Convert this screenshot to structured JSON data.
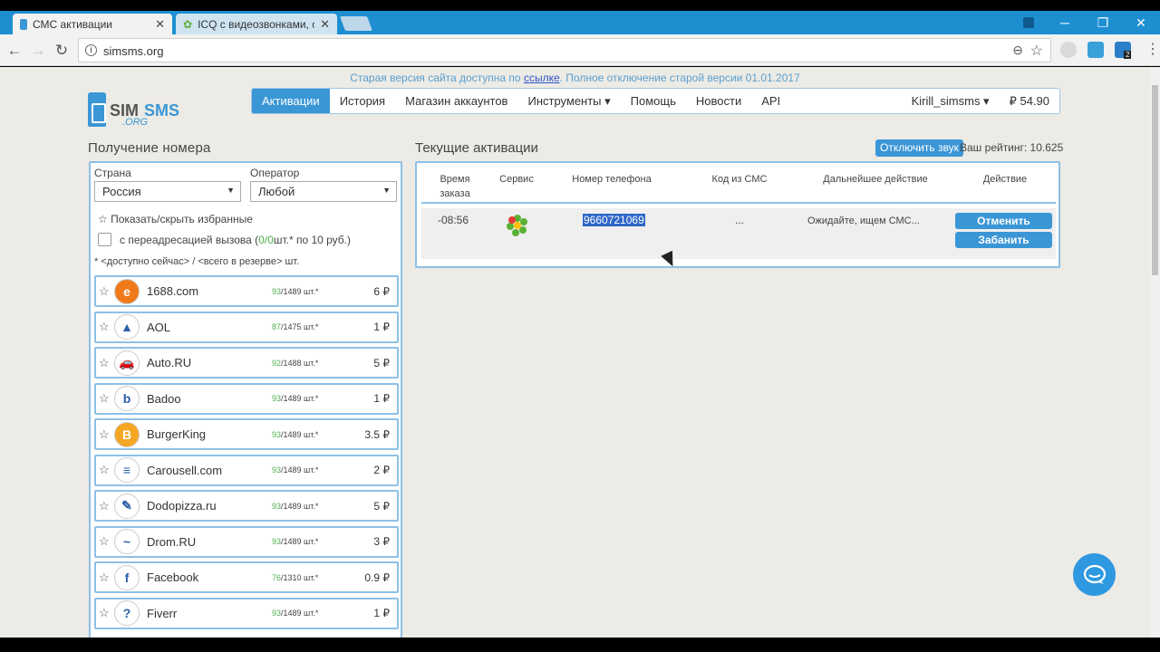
{
  "browser": {
    "tabs": [
      {
        "title": "СМС активации",
        "close": "✕"
      },
      {
        "title": "ICQ с видеозвонками, с",
        "close": "✕"
      }
    ],
    "url": "simsms.org",
    "ext_badge": "2"
  },
  "page": {
    "notice_prefix": "Старая версия сайта доступна по ",
    "notice_link": "ссылке",
    "notice_suffix": ". Полное отключение старой версии 01.01.2017",
    "logo": {
      "sim": "SIM",
      "sms": "SMS",
      "org": ".ORG"
    },
    "nav": {
      "items": [
        "Активации",
        "История",
        "Магазин аккаунтов",
        "Инструменты ▾",
        "Помощь",
        "Новости",
        "API"
      ],
      "user": "Kirill_simsms ▾",
      "balance": "₽ 54.90"
    },
    "left": {
      "title": "Получение номера",
      "country_label": "Страна",
      "country_value": "Россия",
      "operator_label": "Оператор",
      "operator_value": "Любой",
      "favorites_toggle": "☆ Показать/скрыть избранные",
      "forward_label_prefix": "с переадресацией вызова (",
      "forward_count": "0/0",
      "forward_label_suffix": " шт.* по 10 руб.)",
      "avail_note": "* <доступно сейчас> / <всего в резерве> шт.",
      "services": [
        {
          "name": "1688.com",
          "avail": "93",
          "total": "/1489 шт.*",
          "price": "6 ₽",
          "icon": "orange-swirl-icon",
          "color": "#f07a1a",
          "glyph": "e"
        },
        {
          "name": "AOL",
          "avail": "87",
          "total": "/1475 шт.*",
          "price": "1 ₽",
          "icon": "aol-icon",
          "color": "#ffffff",
          "glyph": "▲"
        },
        {
          "name": "Auto.RU",
          "avail": "92",
          "total": "/1488 шт.*",
          "price": "5 ₽",
          "icon": "car-icon",
          "color": "#ffffff",
          "glyph": "🚗"
        },
        {
          "name": "Badoo",
          "avail": "93",
          "total": "/1489 шт.*",
          "price": "1 ₽",
          "icon": "badoo-icon",
          "color": "#ffffff",
          "glyph": "b"
        },
        {
          "name": "BurgerKing",
          "avail": "93",
          "total": "/1489 шт.*",
          "price": "3.5 ₽",
          "icon": "burgerking-icon",
          "color": "#f5a623",
          "glyph": "B"
        },
        {
          "name": "Carousell.com",
          "avail": "93",
          "total": "/1489 шт.*",
          "price": "2 ₽",
          "icon": "carousell-icon",
          "color": "#ffffff",
          "glyph": "≡"
        },
        {
          "name": "Dodopizza.ru",
          "avail": "93",
          "total": "/1489 шт.*",
          "price": "5 ₽",
          "icon": "dodo-icon",
          "color": "#ffffff",
          "glyph": "✎"
        },
        {
          "name": "Drom.RU",
          "avail": "93",
          "total": "/1489 шт.*",
          "price": "3 ₽",
          "icon": "drom-icon",
          "color": "#ffffff",
          "glyph": "~"
        },
        {
          "name": "Facebook",
          "avail": "76",
          "total": "/1310 шт.*",
          "price": "0.9 ₽",
          "icon": "facebook-icon",
          "color": "#ffffff",
          "glyph": "f"
        },
        {
          "name": "Fiverr",
          "avail": "93",
          "total": "/1489 шт.*",
          "price": "1 ₽",
          "icon": "question-icon",
          "color": "#ffffff",
          "glyph": "?"
        }
      ]
    },
    "right": {
      "title": "Текущие активации",
      "sound_button": "Отключить звук",
      "rating": "Ваш рейтинг: 10.625",
      "headers": {
        "time": "Время заказа",
        "service": "Сервис",
        "phone": "Номер телефона",
        "code": "Код из СМС",
        "next": "Дальнейшее действие",
        "action": "Действие"
      },
      "row": {
        "time": "-08:56",
        "phone": "9660721069",
        "code": "...",
        "status": "Ожидайте, ищем СМС...",
        "cancel": "Отменить",
        "ban": "Забанить"
      }
    }
  }
}
